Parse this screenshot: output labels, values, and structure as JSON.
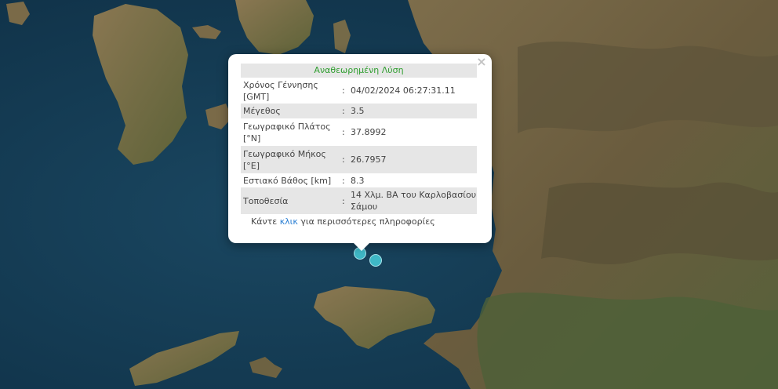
{
  "popup": {
    "title": "Αναθεωρημένη Λύση",
    "close_symbol": "×",
    "rows": [
      {
        "label": "Χρόνος Γέννησης [GMT]",
        "value": "04/02/2024 06:27:31.11"
      },
      {
        "label": "Μέγεθος",
        "value": "3.5"
      },
      {
        "label": "Γεωγραφικό Πλάτος [°N]",
        "value": "37.8992"
      },
      {
        "label": "Γεωγραφικό Μήκος [°E]",
        "value": "26.7957"
      },
      {
        "label": "Εστιακό Βάθος [km]",
        "value": "8.3"
      },
      {
        "label": "Τοποθεσία",
        "value": "14 Χλμ. ΒΑ του Καρλοβασίου Σάμου"
      }
    ],
    "separator": ":",
    "more_prefix": "Κάντε ",
    "more_link": "κλικ",
    "more_suffix": " για περισσότερες πληροφορίες"
  },
  "map": {
    "imagery": "satellite",
    "marker_color": "#3fb8c6",
    "colors": {
      "sea": "#17405a",
      "land": "#7a6a48",
      "land_green": "#4f5f3a",
      "mountain": "#5c5238"
    }
  }
}
